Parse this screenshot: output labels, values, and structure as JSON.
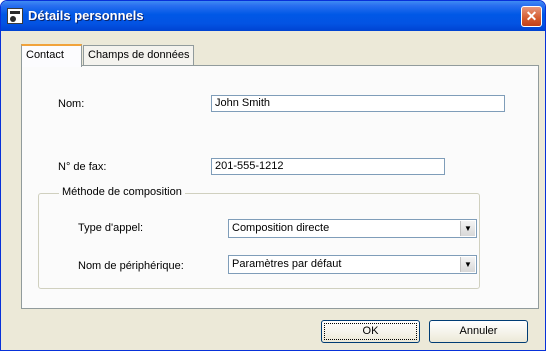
{
  "window": {
    "title": "Détails personnels",
    "close_glyph": "✕"
  },
  "tabs": [
    {
      "label": "Contact",
      "active": true
    },
    {
      "label": "Champs de données",
      "active": false
    }
  ],
  "form": {
    "name_label": "Nom:",
    "name_value": "John Smith",
    "fax_label": "N° de fax:",
    "fax_value": "201-555-1212",
    "group_title": "Méthode de composition",
    "call_type_label": "Type d'appel:",
    "call_type_value": "Composition directe",
    "device_label": "Nom de périphérique:",
    "device_value": "Paramètres par défaut"
  },
  "buttons": {
    "ok": "OK",
    "cancel": "Annuler"
  },
  "icons": {
    "dropdown": "▼",
    "app": "contact-card-icon"
  },
  "colors": {
    "titlebar": "#0058e6",
    "face": "#ece9d8",
    "close": "#d55b2e",
    "tab_highlight": "#f1a33b"
  }
}
